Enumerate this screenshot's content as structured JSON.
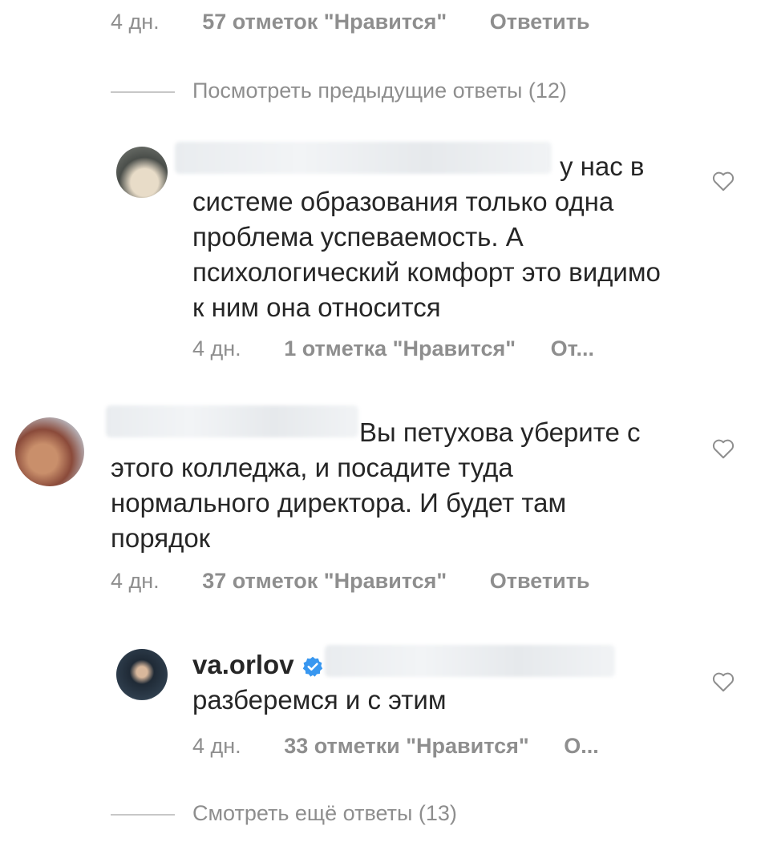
{
  "top_meta": {
    "time": "4 дн.",
    "likes": "57 отметок \"Нравится\"",
    "reply": "Ответить"
  },
  "view_previous": "Посмотреть предыдущие ответы (12)",
  "comment1": {
    "text": "у нас в системе образования только одна проблема успеваемость.  А психологический комфорт это видимо к ним она относится",
    "time": "4 дн.",
    "likes": "1 отметка \"Нравится\"",
    "reply": "От..."
  },
  "comment2": {
    "text": "Вы петухова уберите с этого колледжа, и посадите туда нормального директора. И будет там порядок",
    "time": "4 дн.",
    "likes": "37 отметок \"Нравится\"",
    "reply": "Ответить"
  },
  "comment3": {
    "username": "va.orlov",
    "text": "разберемся и с этим",
    "time": "4 дн.",
    "likes": "33 отметки \"Нравится\"",
    "reply": "О..."
  },
  "view_more": "Смотреть ещё ответы (13)",
  "colors": {
    "text": "#262626",
    "muted": "#8e8e8e",
    "verified": "#3897f0"
  },
  "icons": [
    "heart-outline-icon",
    "verified-badge-icon"
  ]
}
